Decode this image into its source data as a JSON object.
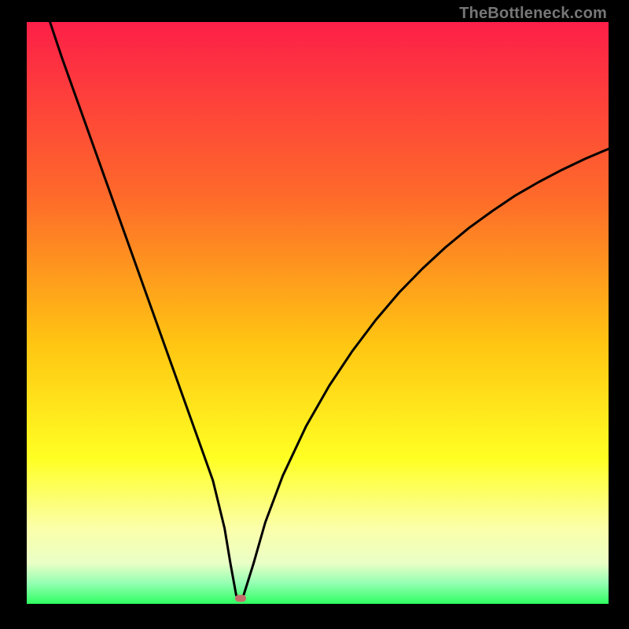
{
  "watermark": "TheBottleneck.com",
  "colors": {
    "background": "#000000",
    "gradient_top": "#fd1f48",
    "gradient_upper": "#fe6a2a",
    "gradient_mid": "#ffc412",
    "gradient_lower_yellow": "#ffff23",
    "gradient_pale": "#fbffa9",
    "gradient_green": "#2eff61",
    "curve": "#000000",
    "marker": "#c66d6b"
  },
  "chart_data": {
    "type": "line",
    "title": "",
    "xlabel": "",
    "ylabel": "",
    "xlim": [
      0,
      100
    ],
    "ylim": [
      0,
      100
    ],
    "grid": false,
    "legend": false,
    "x": [
      4,
      6,
      8,
      10,
      12,
      14,
      16,
      18,
      20,
      22,
      24,
      26,
      28,
      30,
      32,
      34,
      35,
      36,
      36.5,
      37,
      39,
      41,
      44,
      48,
      52,
      56,
      60,
      64,
      68,
      72,
      76,
      80,
      84,
      88,
      92,
      96,
      100
    ],
    "values": [
      100,
      94,
      88.4,
      82.8,
      77.2,
      71.6,
      66,
      60.4,
      54.8,
      49.2,
      43.6,
      38,
      32.4,
      26.8,
      21.2,
      13,
      7,
      1.5,
      0.6,
      0.6,
      7,
      14,
      22,
      30.5,
      37.5,
      43.5,
      48.8,
      53.5,
      57.6,
      61.3,
      64.6,
      67.5,
      70.2,
      72.5,
      74.6,
      76.5,
      78.2
    ],
    "marker": {
      "x": 36.8,
      "y": 0.9
    },
    "gradient_stops": [
      {
        "pos": 0.0,
        "color": "#fd1f48"
      },
      {
        "pos": 0.3,
        "color": "#fe6a2a"
      },
      {
        "pos": 0.55,
        "color": "#ffc412"
      },
      {
        "pos": 0.75,
        "color": "#ffff23"
      },
      {
        "pos": 0.87,
        "color": "#fbffa9"
      },
      {
        "pos": 0.93,
        "color": "#eaffc6"
      },
      {
        "pos": 0.965,
        "color": "#93ffb2"
      },
      {
        "pos": 1.0,
        "color": "#2eff61"
      }
    ]
  }
}
